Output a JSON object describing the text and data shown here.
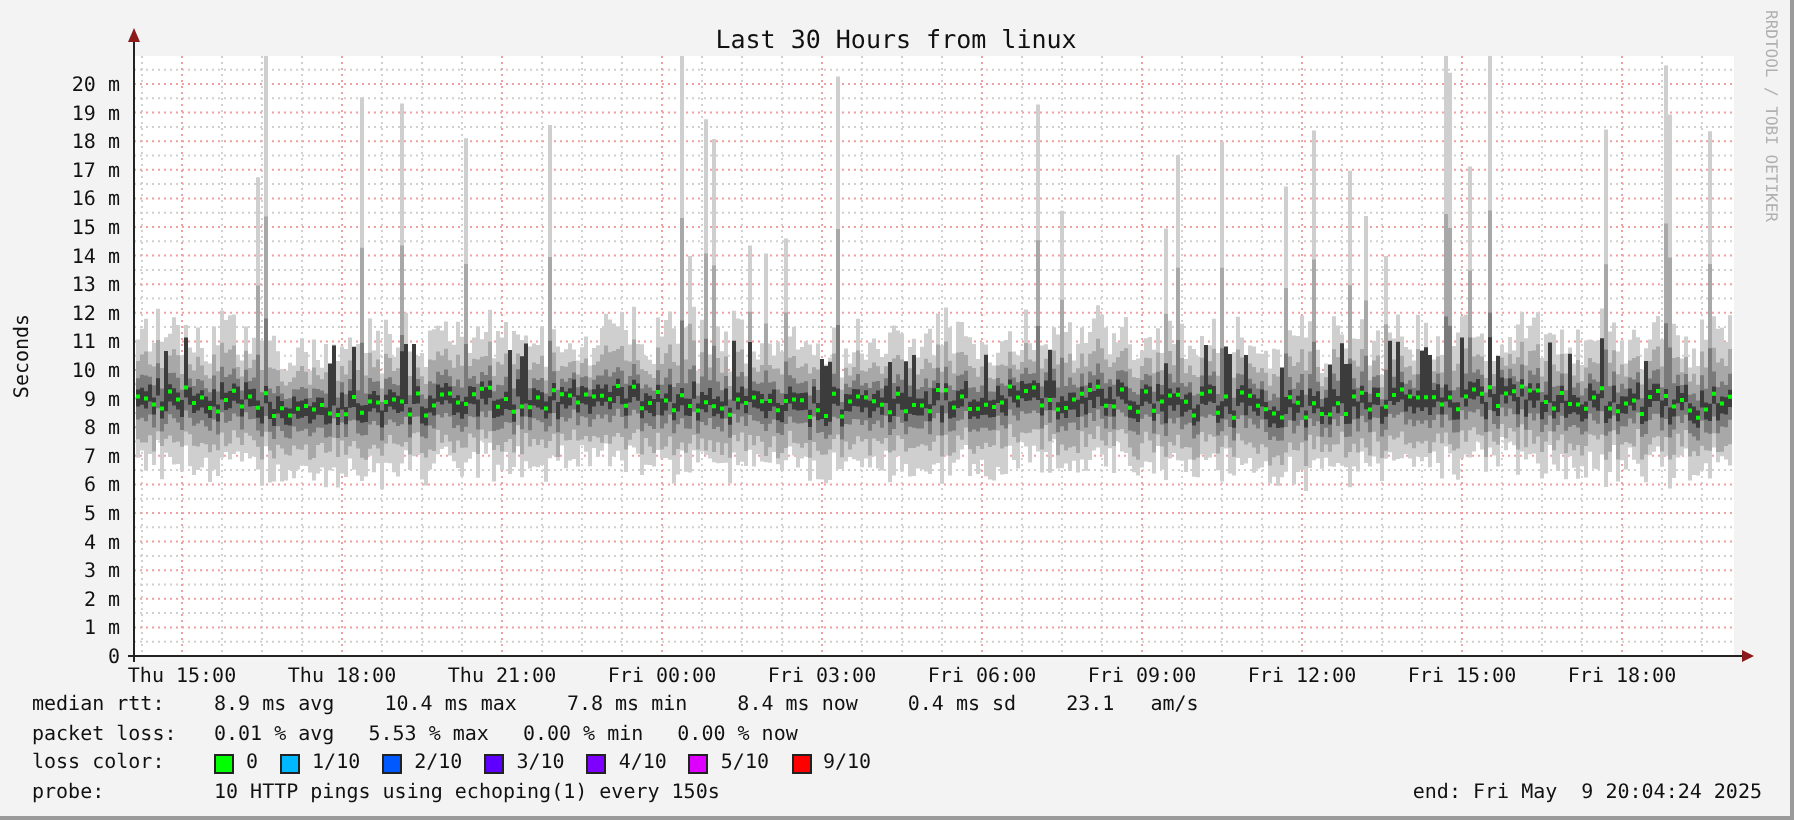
{
  "title": "Last 30 Hours from linux",
  "credit": "RRDTOOL / TOBI OETIKER",
  "y_axis": {
    "label": "Seconds",
    "ticks": [
      "20 m",
      "19 m",
      "18 m",
      "17 m",
      "16 m",
      "15 m",
      "14 m",
      "13 m",
      "12 m",
      "11 m",
      "10 m",
      "9 m",
      "8 m",
      "7 m",
      "6 m",
      "5 m",
      "4 m",
      "3 m",
      "2 m",
      "1 m",
      "0"
    ]
  },
  "x_axis": {
    "ticks": [
      "Thu 15:00",
      "Thu 18:00",
      "Thu 21:00",
      "Fri 00:00",
      "Fri 03:00",
      "Fri 06:00",
      "Fri 09:00",
      "Fri 12:00",
      "Fri 15:00",
      "Fri 18:00"
    ]
  },
  "median_rtt": {
    "label": "median rtt:",
    "values": [
      "8.9 ms avg",
      "10.4 ms max",
      "7.8 ms min",
      "8.4 ms now",
      "0.4 ms sd",
      "23.1   am/s"
    ]
  },
  "packet_loss": {
    "label": "packet loss:",
    "values": [
      "0.01 % avg",
      "5.53 % max",
      "0.00 % min",
      "0.00 % now"
    ]
  },
  "loss_color": {
    "label": "loss color:",
    "items": [
      {
        "label": "0",
        "color": "#00ff00"
      },
      {
        "label": "1/10",
        "color": "#00b8ff"
      },
      {
        "label": "2/10",
        "color": "#0059ff"
      },
      {
        "label": "3/10",
        "color": "#5e00ff"
      },
      {
        "label": "4/10",
        "color": "#7e00ff"
      },
      {
        "label": "5/10",
        "color": "#dd00ff"
      },
      {
        "label": "9/10",
        "color": "#ff0000"
      }
    ]
  },
  "probe": {
    "label": "probe:",
    "text": "10 HTTP pings using echoping(1) every 150s",
    "end": "end: Fri May  9 20:04:24 2025"
  }
}
